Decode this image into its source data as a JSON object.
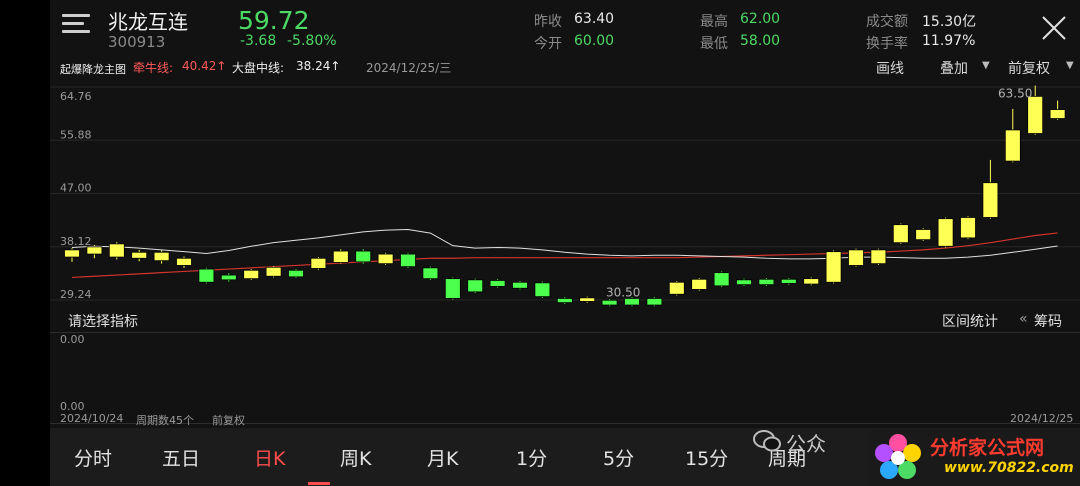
{
  "header": {
    "stock_name": "兆龙互连",
    "stock_code": "300913",
    "price": "59.72",
    "change": "-3.68",
    "change_pct": "-5.80%",
    "stats": [
      {
        "label": "昨收",
        "value": "63.40",
        "color": "white"
      },
      {
        "label": "今开",
        "value": "60.00",
        "color": "green"
      },
      {
        "label": "最高",
        "value": "62.00",
        "color": "green"
      },
      {
        "label": "最低",
        "value": "58.00",
        "color": "green"
      },
      {
        "label": "成交额",
        "value": "15.30亿",
        "color": "white"
      },
      {
        "label": "换手率",
        "value": "11.97%",
        "color": "white"
      }
    ]
  },
  "indicator_bar": {
    "name": "起爆降龙主图",
    "niu_label": "牵牛线:",
    "niu_value": "40.42↑",
    "dapan_label": "大盘中线:",
    "dapan_value": "38.24↑",
    "date": "2024/12/25/三",
    "draw_label": "画线",
    "overlay_label": "叠加",
    "adjust_label": "前复权"
  },
  "sub_panel": {
    "select_label": "请选择指标",
    "range_stat_label": "区间统计",
    "chips_label": "筹码",
    "y_top": "0.00",
    "y_bottom": "0.00",
    "start_date": "2024/10/24",
    "period_count": "周期数45个",
    "adjust": "前复权",
    "end_date": "2024/12/25"
  },
  "tabs": [
    {
      "label": "分时",
      "active": false
    },
    {
      "label": "五日",
      "active": false
    },
    {
      "label": "日K",
      "active": true
    },
    {
      "label": "周K",
      "active": false
    },
    {
      "label": "月K",
      "active": false
    },
    {
      "label": "1分",
      "active": false
    },
    {
      "label": "5分",
      "active": false
    },
    {
      "label": "15分",
      "active": false
    },
    {
      "label": "周期",
      "active": false
    }
  ],
  "watermark": {
    "wechat": "公众",
    "brand": "分析家公式网",
    "url": "www.70822.com"
  },
  "colors": {
    "up": "#ffff55",
    "down": "#4cff4c",
    "niu_line": "#d0342c",
    "dapan_line": "#e0e0e0",
    "accent": "#ff4d4d"
  },
  "chart_data": {
    "type": "candlestick",
    "y_ticks": [
      "64.76",
      "55.88",
      "47.00",
      "38.12",
      "29.24"
    ],
    "ylim": [
      29.24,
      64.76
    ],
    "annotations": [
      {
        "text": "63.50",
        "value": 63.5
      },
      {
        "text": "30.50",
        "value": 30.5
      }
    ],
    "candles": [
      [
        36.4,
        37.6,
        35.6,
        37.9
      ],
      [
        36.9,
        38.1,
        36.2,
        38.4
      ],
      [
        36.4,
        38.6,
        36.0,
        38.9
      ],
      [
        36.2,
        37.2,
        35.7,
        37.6
      ],
      [
        35.8,
        37.2,
        35.3,
        37.5
      ],
      [
        35.0,
        36.2,
        34.6,
        36.5
      ],
      [
        34.4,
        32.2,
        32.0,
        34.6
      ],
      [
        33.4,
        32.6,
        32.3,
        33.7
      ],
      [
        32.8,
        34.2,
        32.6,
        34.4
      ],
      [
        33.2,
        34.7,
        33.0,
        34.9
      ],
      [
        34.2,
        33.1,
        32.9,
        34.4
      ],
      [
        34.5,
        36.2,
        34.3,
        36.4
      ],
      [
        35.5,
        37.4,
        35.3,
        37.7
      ],
      [
        37.4,
        35.6,
        35.3,
        37.7
      ],
      [
        35.3,
        36.9,
        35.1,
        37.1
      ],
      [
        36.9,
        34.8,
        34.6,
        37.1
      ],
      [
        34.6,
        32.8,
        32.6,
        34.8
      ],
      [
        32.8,
        29.5,
        29.3,
        33.0
      ],
      [
        32.6,
        30.6,
        30.4,
        32.8
      ],
      [
        32.5,
        31.5,
        31.3,
        32.7
      ],
      [
        32.2,
        31.2,
        31.0,
        32.4
      ],
      [
        32.1,
        29.8,
        29.6,
        32.3
      ],
      [
        29.5,
        28.8,
        28.6,
        29.7
      ],
      [
        29.0,
        29.6,
        28.8,
        29.8
      ],
      [
        29.2,
        28.4,
        28.2,
        29.4
      ],
      [
        29.5,
        28.4,
        28.2,
        29.7
      ],
      [
        29.5,
        28.4,
        28.2,
        29.7
      ],
      [
        30.2,
        32.2,
        30.0,
        32.4
      ],
      [
        31.0,
        32.7,
        30.8,
        32.9
      ],
      [
        33.8,
        31.6,
        31.4,
        34.0
      ],
      [
        32.6,
        31.8,
        31.6,
        32.8
      ],
      [
        32.7,
        31.8,
        31.6,
        32.9
      ],
      [
        32.7,
        32.0,
        31.8,
        32.9
      ],
      [
        31.9,
        32.8,
        31.7,
        33.0
      ],
      [
        32.2,
        37.3,
        32.0,
        37.5
      ],
      [
        35.0,
        37.6,
        34.8,
        37.8
      ],
      [
        35.3,
        37.6,
        35.1,
        37.8
      ],
      [
        38.8,
        41.8,
        38.6,
        42.0
      ],
      [
        39.3,
        41.0,
        39.1,
        41.2
      ],
      [
        38.2,
        42.8,
        38.0,
        43.0
      ],
      [
        39.6,
        43.0,
        39.4,
        43.2
      ],
      [
        43.0,
        48.8,
        42.8,
        52.6
      ],
      [
        52.4,
        57.6,
        52.2,
        61.1
      ],
      [
        57.0,
        63.2,
        56.8,
        65.0
      ],
      [
        59.5,
        61.0,
        59.3,
        62.5
      ]
    ],
    "niu_line": [
      33.0,
      33.2,
      33.4,
      33.6,
      33.8,
      34.0,
      34.2,
      34.4,
      34.6,
      34.8,
      35.0,
      35.2,
      35.4,
      35.6,
      35.8,
      36.0,
      36.2,
      36.2,
      36.3,
      36.3,
      36.3,
      36.3,
      36.3,
      36.3,
      36.3,
      36.3,
      36.3,
      36.3,
      36.4,
      36.5,
      36.6,
      36.7,
      36.8,
      36.9,
      37.0,
      37.1,
      37.2,
      37.4,
      37.6,
      37.9,
      38.3,
      38.8,
      39.4,
      40.0,
      40.42
    ],
    "dapan_line": [
      38.0,
      38.2,
      38.1,
      37.9,
      37.6,
      37.3,
      37.0,
      37.5,
      38.2,
      38.8,
      39.2,
      39.6,
      40.1,
      40.6,
      40.9,
      41.0,
      40.4,
      38.3,
      37.9,
      38.0,
      37.9,
      37.6,
      37.2,
      36.9,
      36.7,
      36.6,
      36.7,
      36.7,
      36.6,
      36.5,
      36.4,
      36.2,
      36.1,
      36.1,
      36.2,
      36.4,
      36.4,
      36.3,
      36.2,
      36.2,
      36.4,
      36.7,
      37.2,
      37.7,
      38.24
    ]
  }
}
